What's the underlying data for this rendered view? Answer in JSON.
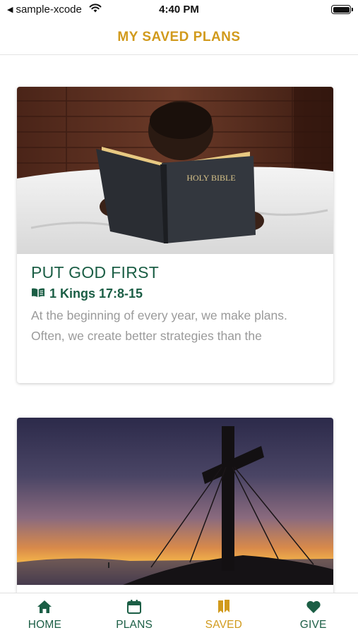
{
  "status_bar": {
    "back_label": "sample-xcode",
    "time": "4:40 PM"
  },
  "header": {
    "title": "MY SAVED PLANS"
  },
  "plans": [
    {
      "title": "PUT GOD FIRST",
      "scripture": "1 Kings 17:8-15",
      "description": "At the beginning of every year, we make plans. Often, we create better strategies than the",
      "image_icon": "bible-reading-photo",
      "image_text": "HOLY BIBLE"
    },
    {
      "image_icon": "cross-sunset-photo"
    }
  ],
  "tabs": [
    {
      "label": "HOME",
      "icon": "home-icon"
    },
    {
      "label": "PLANS",
      "icon": "calendar-icon"
    },
    {
      "label": "SAVED",
      "icon": "bookmark-icon"
    },
    {
      "label": "GIVE",
      "icon": "heart-icon"
    }
  ],
  "colors": {
    "brand_green": "#1b5e45",
    "accent_gold": "#d19a1c",
    "muted_text": "#9a9a9a"
  }
}
